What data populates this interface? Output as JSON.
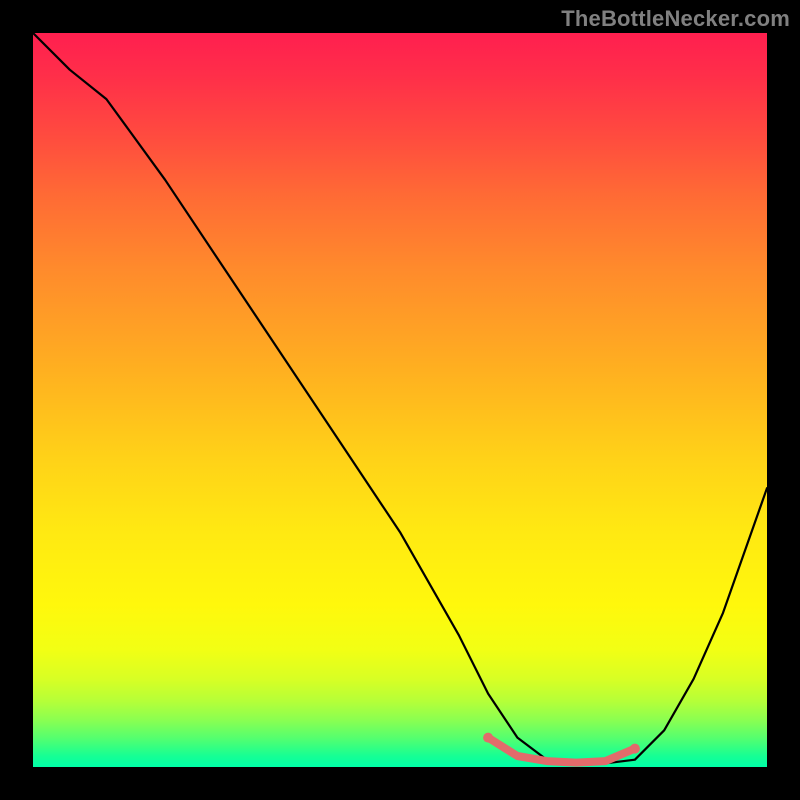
{
  "watermark": "TheBottleNecker.com",
  "colors": {
    "frame": "#000000",
    "curve": "#000000",
    "highlight": "#e26b6b",
    "watermark": "#808080"
  },
  "chart_data": {
    "type": "line",
    "title": "",
    "xlabel": "",
    "ylabel": "",
    "xlim": [
      0,
      100
    ],
    "ylim": [
      0,
      100
    ],
    "curve": {
      "x": [
        0,
        5,
        10,
        18,
        26,
        34,
        42,
        50,
        58,
        62,
        66,
        70,
        74,
        78,
        82,
        86,
        90,
        94,
        100
      ],
      "y": [
        100,
        95,
        91,
        80,
        68,
        56,
        44,
        32,
        18,
        10,
        4,
        1,
        0.5,
        0.5,
        1,
        5,
        12,
        21,
        38
      ]
    },
    "highlight_segment": {
      "x": [
        62,
        66,
        70,
        74,
        78,
        82
      ],
      "y": [
        4,
        1.5,
        0.8,
        0.6,
        0.8,
        2.5
      ]
    },
    "gradient_stops": [
      {
        "pct": 0,
        "color": "#ff1f4f"
      },
      {
        "pct": 32,
        "color": "#ff8a2c"
      },
      {
        "pct": 58,
        "color": "#ffd218"
      },
      {
        "pct": 78,
        "color": "#fff80c"
      },
      {
        "pct": 93.5,
        "color": "#8cff50"
      },
      {
        "pct": 100,
        "color": "#00ffa8"
      }
    ]
  }
}
